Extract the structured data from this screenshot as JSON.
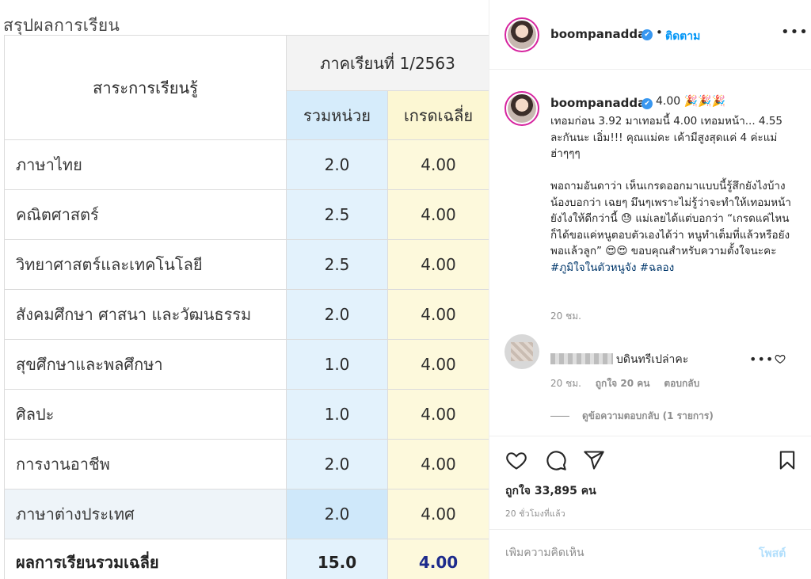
{
  "report": {
    "title": "สรุปผลการเรียน",
    "subject_header": "สาระการเรียนรู้",
    "term_header": "ภาคเรียนที่ 1/2563",
    "units_header": "รวมหน่วย",
    "grade_header": "เกรดเฉลี่ย",
    "rows": [
      {
        "subject": "ภาษาไทย",
        "units": "2.0",
        "grade": "4.00"
      },
      {
        "subject": "คณิตศาสตร์",
        "units": "2.5",
        "grade": "4.00"
      },
      {
        "subject": "วิทยาศาสตร์และเทคโนโลยี",
        "units": "2.5",
        "grade": "4.00"
      },
      {
        "subject": "สังคมศึกษา ศาสนา และวัฒนธรรม",
        "units": "2.0",
        "grade": "4.00"
      },
      {
        "subject": "สุขศึกษาและพลศึกษา",
        "units": "1.0",
        "grade": "4.00"
      },
      {
        "subject": "ศิลปะ",
        "units": "1.0",
        "grade": "4.00"
      },
      {
        "subject": "การงานอาชีพ",
        "units": "2.0",
        "grade": "4.00"
      },
      {
        "subject": "ภาษาต่างประเทศ",
        "units": "2.0",
        "grade": "4.00"
      }
    ],
    "total": {
      "label": "ผลการเรียนรวมเฉลี่ย",
      "units": "15.0",
      "grade": "4.00"
    }
  },
  "post": {
    "username": "boompanadda",
    "verified_icon": "✔",
    "separator": "•",
    "follow_label": "ติดตาม",
    "more_label": "•••",
    "caption_head": "4.00 🎉🎉🎉",
    "caption_body": "เทอมก่อน 3.92 มาเทอมนี้ 4.00 เทอมหน้า... 4.55 ละกันนะ เอิ่ม!!! คุณแม่คะ เค้ามีสูงสุดแค่ 4 ค่ะแม่ ฮ่าๆๆๆ\n\nพอถามอันดาว่า เห็นเกรดออกมาแบบนี้รู้สึกยังไงบ้าง น้องบอกว่า เฉยๆ มึนๆเพราะไม่รู้ว่าจะทำให้เทอมหน้ายังไงให้ดีกว่านี้ 😓 แม่เลยได้แต่บอกว่า “เกรดแค่ไหนก็ได้ขอแค่หนูตอบตัวเองได้ว่า หนูทำเต็มที่แล้วหรือยัง พอแล้วลูก” 😍😍 ขอบคุณสำหรับความตั้งใจนะคะ ",
    "hashtags": "#ภูมิใจในตัวหนูจัง #ฉลอง",
    "caption_time": "20 ชม.",
    "likes": "ถูกใจ 33,895 คน",
    "post_time": "20 ชั่วโมงที่แล้ว",
    "comment_placeholder": "เพิ่มความคิดเห็น",
    "post_button": "โพสต์"
  },
  "comment": {
    "text": "บดินทรีเปล่าคะ",
    "more_label": "•••",
    "time": "20 ชม.",
    "likes": "ถูกใจ 20 คน",
    "reply_label": "ตอบกลับ",
    "view_replies": "ดูข้อความตอบกลับ (1 รายการ)"
  },
  "colors": {
    "accent": "#0095f6",
    "units_column": "#e3f2fc",
    "grade_column": "#fdf9dc",
    "total_grade": "#1d2b8c"
  }
}
